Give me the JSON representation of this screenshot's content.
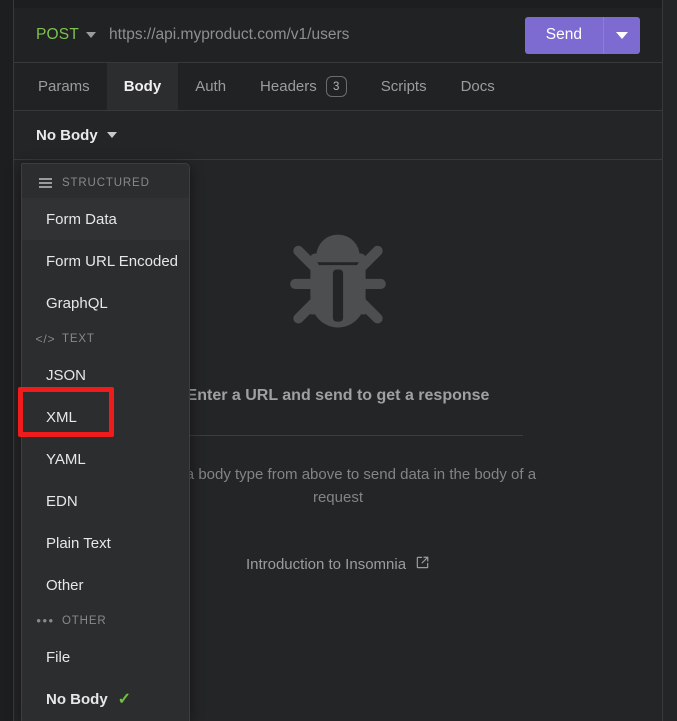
{
  "window": {
    "background_color": "#242526",
    "accent_color": "#7d6bd1"
  },
  "url_bar": {
    "method": "POST",
    "method_caret_icon": "chevron-down-icon",
    "url": "https://api.myproduct.com/v1/users",
    "url_placeholder": "Enter a URL",
    "send_label": "Send",
    "send_caret_icon": "chevron-down-icon",
    "method_color": "#7ec14f"
  },
  "tabs": [
    {
      "label": "Params",
      "active": false,
      "badge": null
    },
    {
      "label": "Body",
      "active": true,
      "badge": null
    },
    {
      "label": "Auth",
      "active": false,
      "badge": null
    },
    {
      "label": "Headers",
      "active": false,
      "badge": "3"
    },
    {
      "label": "Scripts",
      "active": false,
      "badge": null
    },
    {
      "label": "Docs",
      "active": false,
      "badge": null
    }
  ],
  "body_selector": {
    "label": "No Body",
    "caret_icon": "chevron-down-icon"
  },
  "dropdown": {
    "sections": [
      {
        "title": "STRUCTURED",
        "icon": "hamburger-icon",
        "items": [
          {
            "label": "Form Data",
            "hover": true,
            "selected": false
          },
          {
            "label": "Form URL Encoded",
            "hover": false,
            "selected": false
          },
          {
            "label": "GraphQL",
            "hover": false,
            "selected": false
          }
        ]
      },
      {
        "title": "TEXT",
        "icon": "code-icon",
        "items": [
          {
            "label": "JSON",
            "hover": false,
            "selected": false
          },
          {
            "label": "XML",
            "hover": false,
            "selected": false,
            "highlighted": true
          },
          {
            "label": "YAML",
            "hover": false,
            "selected": false
          },
          {
            "label": "EDN",
            "hover": false,
            "selected": false
          },
          {
            "label": "Plain Text",
            "hover": false,
            "selected": false
          },
          {
            "label": "Other",
            "hover": false,
            "selected": false
          }
        ]
      },
      {
        "title": "OTHER",
        "icon": "ellipsis-icon",
        "items": [
          {
            "label": "File",
            "hover": false,
            "selected": false
          },
          {
            "label": "No Body",
            "hover": false,
            "selected": true,
            "check_icon": "check-icon"
          }
        ]
      }
    ]
  },
  "placeholder_pane": {
    "bug_icon": "bug-icon",
    "title": "Enter a URL and send to get a response",
    "subtitle": "Select a body type from above to send data in the body of a request",
    "link_label": "Introduction to Insomnia",
    "link_icon": "external-link-icon"
  },
  "annotation": {
    "target": "XML",
    "color": "#f01c1c"
  }
}
